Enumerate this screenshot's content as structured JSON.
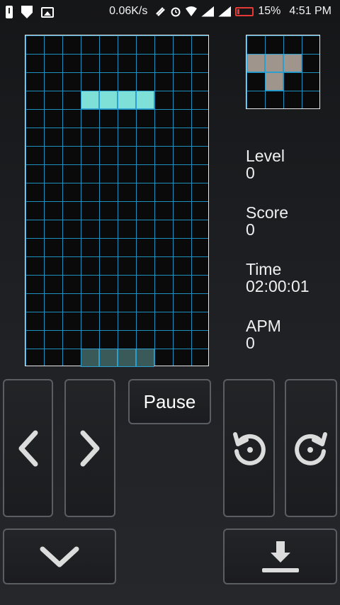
{
  "status_bar": {
    "speed": "0.06K/s",
    "battery": "15%",
    "time": "4:51 PM"
  },
  "board": {
    "cols": 10,
    "rows": 18,
    "active_piece": [
      [
        3,
        3
      ],
      [
        4,
        3
      ],
      [
        5,
        3
      ],
      [
        6,
        3
      ]
    ],
    "ghost_piece": [
      [
        3,
        17
      ],
      [
        4,
        17
      ],
      [
        5,
        17
      ],
      [
        6,
        17
      ]
    ],
    "active_color": "#7ee0d6",
    "ghost_color": "#3a5a5a",
    "grid_color": "#1f8fbf"
  },
  "next_piece": {
    "cells": [
      [
        0,
        1
      ],
      [
        1,
        1
      ],
      [
        2,
        1
      ],
      [
        1,
        2
      ]
    ],
    "color": "#a0958c"
  },
  "stats": {
    "level_label": "Level",
    "level_value": "0",
    "score_label": "Score",
    "score_value": "0",
    "time_label": "Time",
    "time_value": "02:00:01",
    "apm_label": "APM",
    "apm_value": "0"
  },
  "controls": {
    "pause_label": "Pause",
    "left_icon": "chevron-left-icon",
    "right_icon": "chevron-right-icon",
    "rotate_ccw_icon": "rotate-ccw-icon",
    "rotate_cw_icon": "rotate-cw-icon",
    "soft_drop_icon": "chevron-down-icon",
    "hard_drop_icon": "download-arrow-icon"
  }
}
